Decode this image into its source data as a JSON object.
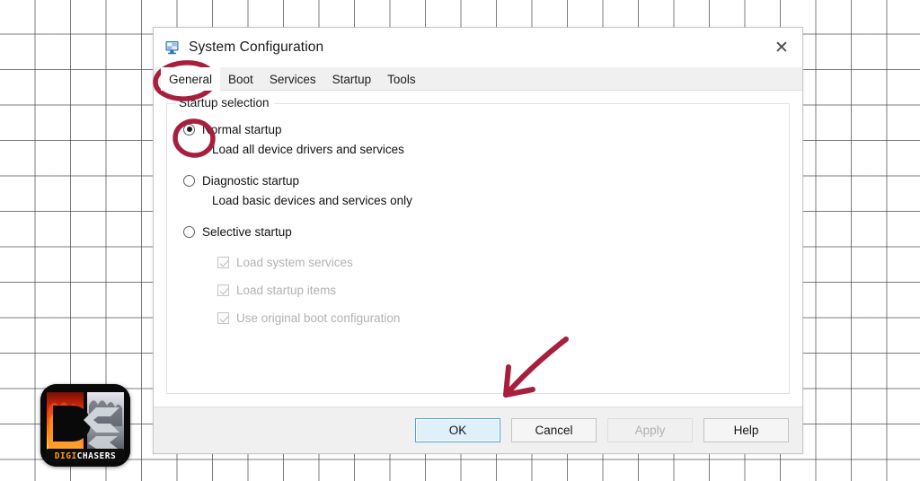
{
  "window": {
    "title": "System Configuration",
    "icon": "system-configuration-icon",
    "close_label": "✕"
  },
  "tabs": [
    {
      "label": "General",
      "active": true
    },
    {
      "label": "Boot",
      "active": false
    },
    {
      "label": "Services",
      "active": false
    },
    {
      "label": "Startup",
      "active": false
    },
    {
      "label": "Tools",
      "active": false
    }
  ],
  "general": {
    "group_label": "Startup selection",
    "options": [
      {
        "label": "Normal startup",
        "description": "Load all device drivers and services",
        "selected": true
      },
      {
        "label": "Diagnostic startup",
        "description": "Load basic devices and services only",
        "selected": false
      },
      {
        "label": "Selective startup",
        "description": "",
        "selected": false
      }
    ],
    "selective_items": [
      {
        "label": "Load system services",
        "checked": true,
        "disabled": true
      },
      {
        "label": "Load startup items",
        "checked": true,
        "disabled": true
      },
      {
        "label": "Use original boot configuration",
        "checked": true,
        "disabled": true
      }
    ]
  },
  "footer": {
    "buttons": [
      {
        "label": "OK",
        "state": "default-focused"
      },
      {
        "label": "Cancel",
        "state": "normal"
      },
      {
        "label": "Apply",
        "state": "disabled"
      },
      {
        "label": "Help",
        "state": "normal"
      }
    ]
  },
  "annotations": {
    "color": "#a81f3e",
    "circle_general_tab": "General",
    "circle_normal_startup_radio": "Normal startup",
    "arrow_to_ok_button": "OK"
  },
  "watermark": {
    "name_part1": "DIGI",
    "name_part2": "CHASERS"
  }
}
